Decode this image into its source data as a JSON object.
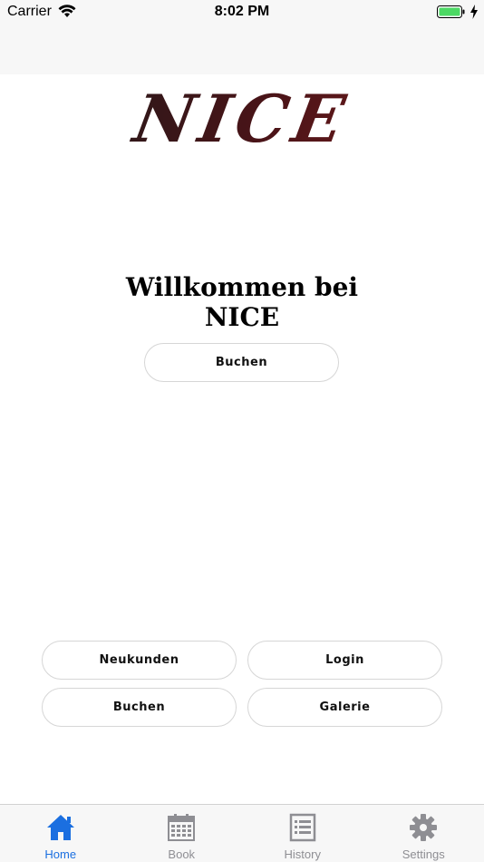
{
  "status": {
    "carrier": "Carrier",
    "time": "8:02 PM"
  },
  "header": {
    "logo": "NICE"
  },
  "main": {
    "welcome_line1": "Willkommen bei",
    "welcome_line2": "NICE",
    "book_button": "Buchen"
  },
  "actions": {
    "new_customers": "Neukunden",
    "login": "Login",
    "book": "Buchen",
    "gallery": "Galerie"
  },
  "tabs": [
    {
      "label": "Home",
      "icon": "home-icon",
      "active": true
    },
    {
      "label": "Book",
      "icon": "calendar-icon",
      "active": false
    },
    {
      "label": "History",
      "icon": "list-icon",
      "active": false
    },
    {
      "label": "Settings",
      "icon": "gear-icon",
      "active": false
    }
  ],
  "colors": {
    "accent": "#1b6fe0",
    "tab_inactive": "#8e8e93",
    "battery": "#4cd964"
  }
}
